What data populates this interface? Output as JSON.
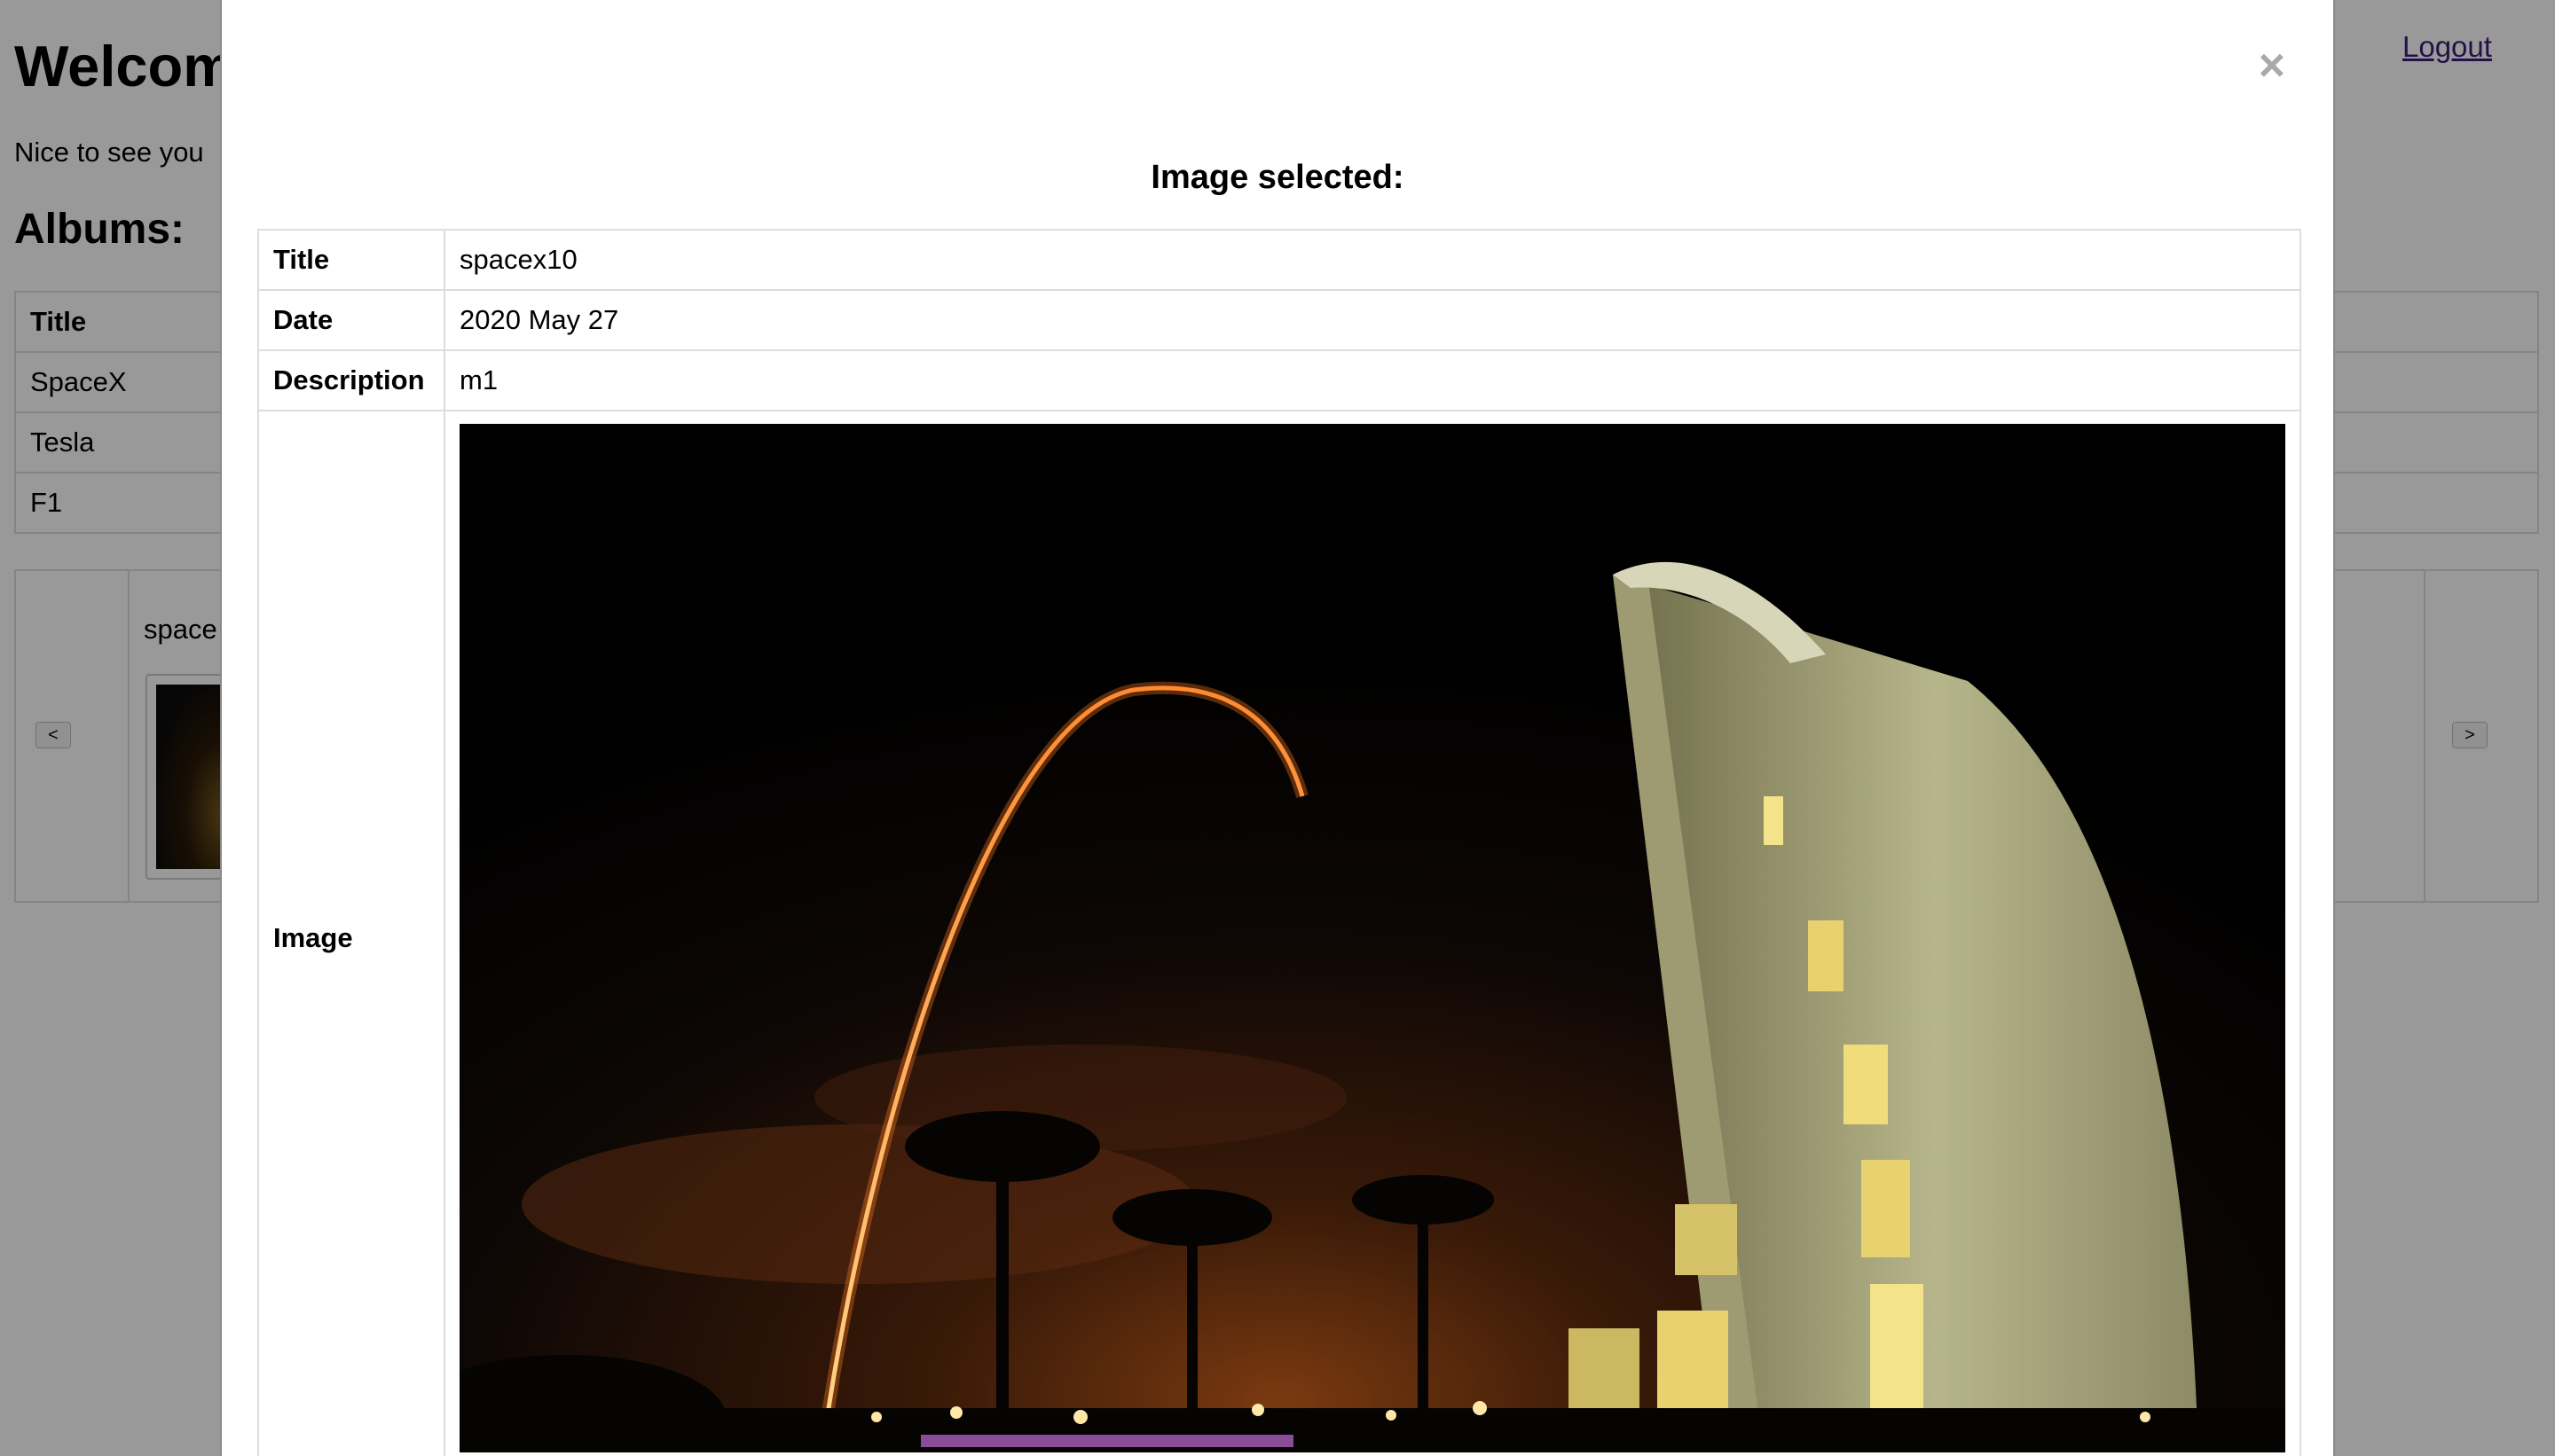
{
  "page": {
    "welcome": "Welcom",
    "subtitle": "Nice to see you",
    "albums_heading": "Albums:",
    "logout": "Logout",
    "albums_table": {
      "header": "Title",
      "rows": [
        "SpaceX",
        "Tesla",
        "F1"
      ]
    },
    "carousel": {
      "caption": "space",
      "prev_label": "<",
      "next_label": ">"
    }
  },
  "modal": {
    "close_label": "×",
    "heading": "Image selected:",
    "fields": {
      "title_key": "Title",
      "title_value": "spacex10",
      "date_key": "Date",
      "date_value": "2020 May 27",
      "description_key": "Description",
      "description_value": "m1",
      "image_key": "Image"
    }
  },
  "colors": {
    "overlay": "rgba(0,0,0,0.4)",
    "link": "#3b1e7a",
    "border": "#dddddd",
    "close": "#aaaaaa"
  }
}
